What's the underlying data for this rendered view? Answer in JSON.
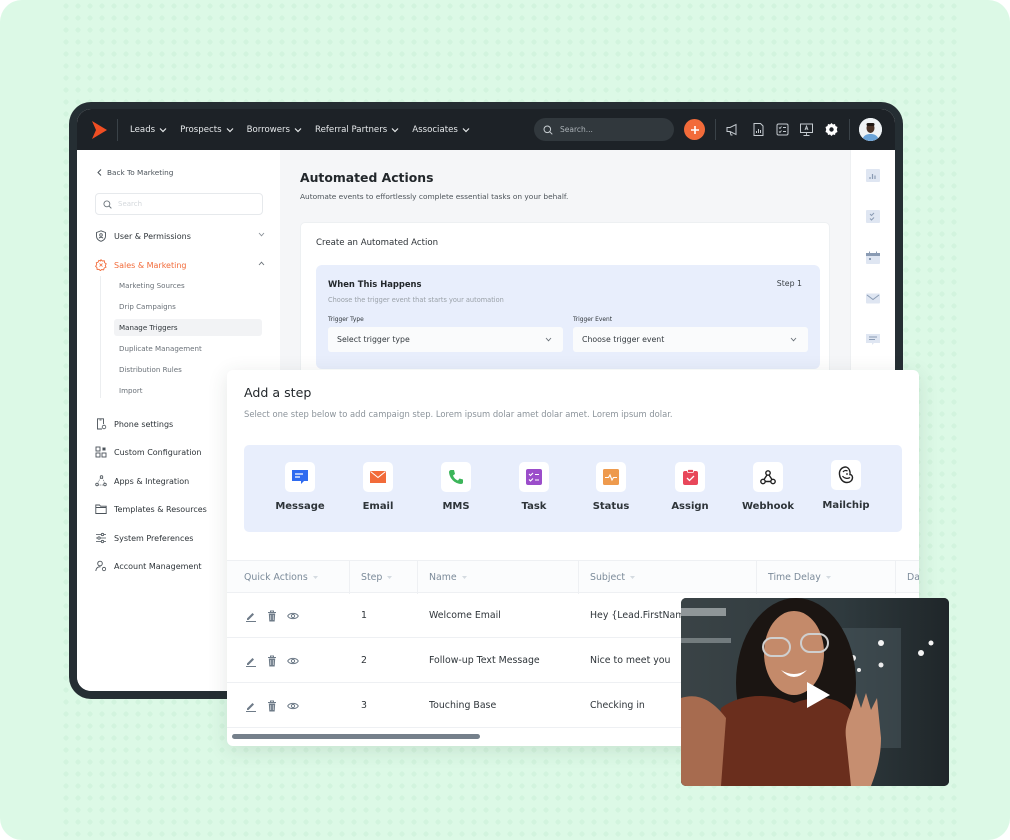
{
  "topbar": {
    "nav": [
      {
        "label": "Leads"
      },
      {
        "label": "Prospects"
      },
      {
        "label": "Borrowers"
      },
      {
        "label": "Referral Partners"
      },
      {
        "label": "Associates"
      }
    ],
    "search_placeholder": "Search...",
    "icons": [
      "megaphone-icon",
      "report-icon",
      "checklist-icon",
      "presentation-icon",
      "gear-icon"
    ],
    "accent": "#f26b3a"
  },
  "sidebar": {
    "back_label": "Back To Marketing",
    "search_placeholder": "Search",
    "items": [
      {
        "label": "User & Permissions",
        "icon": "shield-user-icon",
        "expanded": false
      },
      {
        "label": "Sales & Marketing",
        "icon": "gear-badge-icon",
        "expanded": true,
        "active": true
      },
      {
        "label": "Phone settings",
        "icon": "phone-settings-icon"
      },
      {
        "label": "Custom Configuration",
        "icon": "grid-config-icon"
      },
      {
        "label": "Apps & Integration",
        "icon": "integration-icon"
      },
      {
        "label": "Templates & Resources",
        "icon": "folder-icon"
      },
      {
        "label": "System Preferences",
        "icon": "sliders-icon"
      },
      {
        "label": "Account Management",
        "icon": "user-gear-icon"
      }
    ],
    "sub_items": [
      {
        "label": "Marketing Sources"
      },
      {
        "label": "Drip Campaigns"
      },
      {
        "label": "Manage Triggers",
        "active": true
      },
      {
        "label": "Duplicate Management"
      },
      {
        "label": "Distribution Rules"
      },
      {
        "label": "Import"
      }
    ]
  },
  "main": {
    "title": "Automated Actions",
    "subtitle": "Automate events to effortlessly complete essential tasks on your behalf.",
    "card_title": "Create an Automated Action",
    "trigger": {
      "title": "When This Happens",
      "step": "Step 1",
      "description": "Choose the trigger event that starts your automation",
      "type_label": "Trigger Type",
      "type_value": "Select trigger type",
      "event_label": "Trigger Event",
      "event_value": "Choose trigger event"
    }
  },
  "rail": {
    "icons": [
      "chart-icon",
      "checklist-icon",
      "calendar-icon",
      "mail-icon",
      "comment-icon"
    ]
  },
  "panel": {
    "title": "Add a step",
    "subtitle": "Select one step below to add campaign step. Lorem ipsum dolar amet dolar amet. Lorem ipsum dolar.",
    "steps": [
      {
        "label": "Message",
        "icon": "message-icon",
        "color": "#2f6bf0"
      },
      {
        "label": "Email",
        "icon": "email-icon",
        "color": "#f26b3a"
      },
      {
        "label": "MMS",
        "icon": "phone-icon",
        "color": "#3cb55a"
      },
      {
        "label": "Task",
        "icon": "task-icon",
        "color": "#9b4dca"
      },
      {
        "label": "Status",
        "icon": "status-icon",
        "color": "#ee9a4d"
      },
      {
        "label": "Assign",
        "icon": "assign-icon",
        "color": "#e8475a"
      },
      {
        "label": "Webhook",
        "icon": "webhook-icon",
        "color": "#222222"
      },
      {
        "label": "Mailchip",
        "icon": "mailchimp-icon",
        "color": "#222222"
      }
    ],
    "table": {
      "columns": [
        "Quick Actions",
        "Step",
        "Name",
        "Subject",
        "Time Delay",
        "Da"
      ],
      "rows": [
        {
          "step": "1",
          "name": "Welcome Email",
          "subject": "Hey {Lead.FirstName}"
        },
        {
          "step": "2",
          "name": "Follow-up Text Message",
          "subject": "Nice to meet you"
        },
        {
          "step": "3",
          "name": "Touching Base",
          "subject": "Checking in"
        }
      ]
    }
  },
  "video": {
    "icon": "play-icon"
  }
}
